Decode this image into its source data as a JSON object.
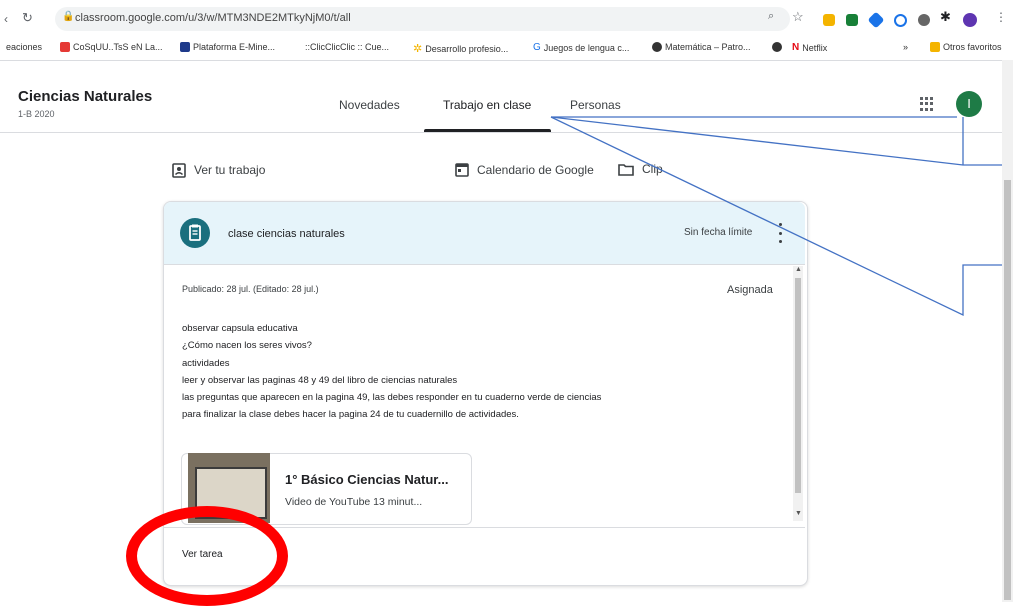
{
  "browser": {
    "url": "classroom.google.com/u/3/w/MTM3NDE2MTkyNjM0/t/all",
    "bookmarks": [
      "eaciones",
      "CoSqUU..TsS eN La...",
      "Plataforma E-Mine...",
      "::ClicClicClic :: Cue...",
      "Desarrollo profesio...",
      "Juegos de lengua c...",
      "Matemática – Patro...",
      "",
      "Netflix"
    ],
    "other_bookmarks": "Otros favoritos"
  },
  "course": {
    "title": "Ciencias Naturales",
    "subtitle": "1-B 2020"
  },
  "tabs": [
    "Novedades",
    "Trabajo en clase",
    "Personas"
  ],
  "avatar_initial": "I",
  "actions": {
    "view_work": "Ver tu trabajo",
    "calendar": "Calendario de Google",
    "folder": "Clip"
  },
  "assignment": {
    "title": "clase ciencias naturales",
    "due": "Sin fecha límite",
    "published": "Publicado: 28 jul. (Editado: 28 jul.)",
    "status": "Asignada",
    "description": [
      "observar capsula educativa",
      "¿Cómo nacen los seres vivos?",
      "actividades",
      "leer y observar las paginas 48 y 49 del libro de ciencias naturales",
      "las preguntas que aparecen en la pagina 49, las debes responder en tu cuaderno verde de ciencias",
      "para finalizar la clase debes hacer la pagina 24 de tu cuadernillo de actividades."
    ],
    "attachment": {
      "title": "1° Básico Ciencias Natur...",
      "subtitle": "Video de YouTube  13 minut..."
    },
    "view_link": "Ver tarea"
  },
  "colors": {
    "accent": "#1a6f7e",
    "header_bg": "#e6f4fa",
    "annotation_red": "#ff0000",
    "annotation_blue": "#4472c4",
    "avatar": "#1e7b46"
  }
}
